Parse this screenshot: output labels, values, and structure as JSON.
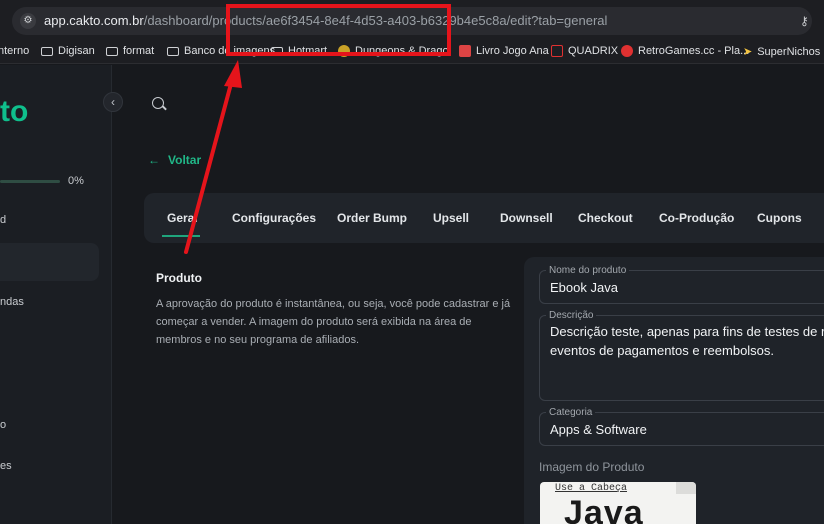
{
  "browser": {
    "url_host": "app.cakto.com.br",
    "url_path": "/dashboard/products/ae6f3454-8e4f-4d53-a403-b6329b4e5c8a/edit?tab=general",
    "bookmarks": [
      {
        "label": "nterno",
        "icon": "none"
      },
      {
        "label": "Digisan",
        "icon": "folder-icon"
      },
      {
        "label": "format",
        "icon": "folder-icon"
      },
      {
        "label": "Banco de imagens",
        "icon": "folder-icon"
      },
      {
        "label": "Hotmart",
        "icon": "folder-icon"
      },
      {
        "label": "Dungeons & Drago",
        "icon": "dnd-icon"
      },
      {
        "label": "Livro Jogo Ana",
        "icon": "bookmark-favicon"
      },
      {
        "label": "QUADRIX",
        "icon": "quadrix-icon"
      },
      {
        "label": "RetroGames.cc - Pla...",
        "icon": "retrogames-icon"
      },
      {
        "label": "SuperNichos",
        "icon": "supernichos-icon"
      }
    ]
  },
  "sidebar": {
    "logo_fragment": "to",
    "collapse_glyph": "‹",
    "progress_pct": "0%",
    "items": [
      "d",
      "ndas",
      "",
      "o",
      "es"
    ]
  },
  "header": {
    "back_label": "Voltar"
  },
  "tabs": [
    "Geral",
    "Configurações",
    "Order Bump",
    "Upsell",
    "Downsell",
    "Checkout",
    "Co-Produção",
    "Cupons"
  ],
  "section": {
    "title": "Produto",
    "description": "A aprovação do produto é instantânea, ou seja, você pode cadastrar e já começar a vender. A imagem do produto será exibida na área de membros e no seu programa de afiliados."
  },
  "form": {
    "name_label": "Nome do produto",
    "name_value": "Ebook Java",
    "desc_label": "Descrição",
    "desc_line1": "Descrição teste, apenas para fins de testes de r",
    "desc_line2": "eventos de pagamentos e reembolsos.",
    "category_label": "Categoria",
    "category_value": "Apps & Software",
    "image_label": "Imagem do Produto",
    "book_subtitle": "Use a Cabeça",
    "book_title": "Java"
  },
  "annotation": {
    "color": "#e5141b"
  }
}
